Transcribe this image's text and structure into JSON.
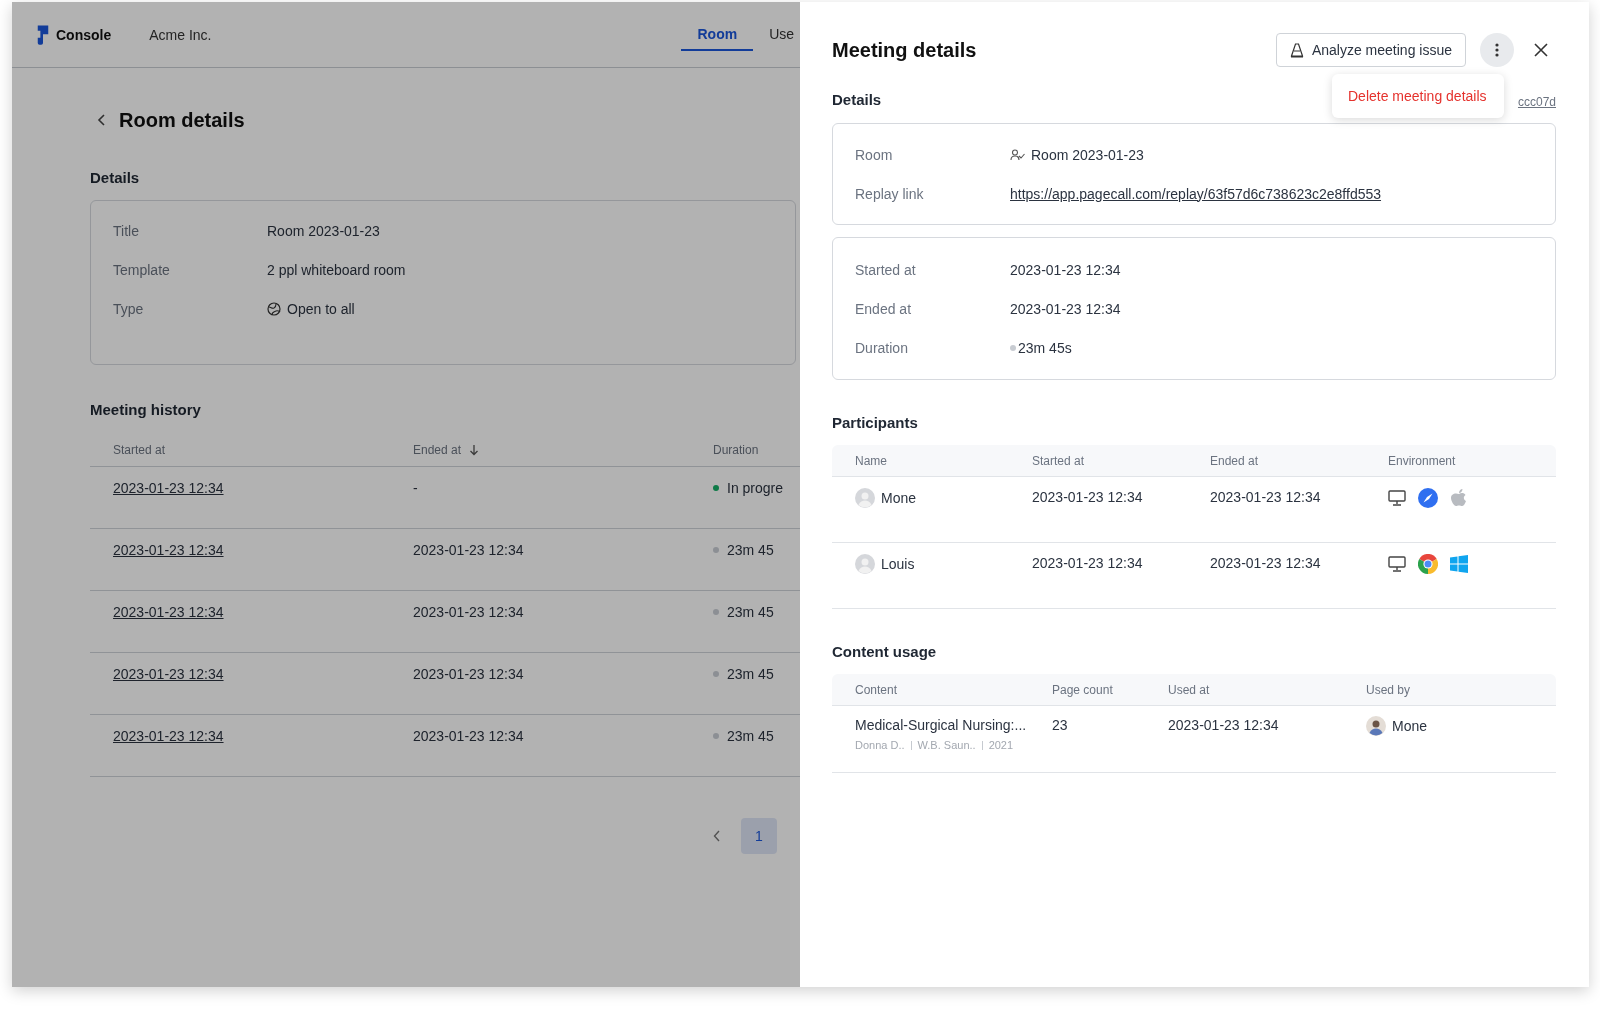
{
  "header": {
    "brand": "Console",
    "org": "Acme Inc.",
    "tabs": [
      {
        "label": "Room",
        "selected": true
      },
      {
        "label": "Use",
        "selected": false
      }
    ]
  },
  "page": {
    "title": "Room details",
    "details_heading": "Details",
    "details": [
      {
        "label": "Title",
        "value": "Room 2023-01-23",
        "kind": "plain"
      },
      {
        "label": "Template",
        "value": "2 ppl whiteboard room",
        "kind": "plain"
      },
      {
        "label": "Type",
        "value": "Open to all",
        "kind": "globe"
      }
    ],
    "history": {
      "heading": "Meeting history",
      "columns": [
        {
          "label": "Started at",
          "sorted": false
        },
        {
          "label": "Ended at",
          "sorted": true
        },
        {
          "label": "Duration",
          "sorted": false
        }
      ],
      "rows": [
        {
          "started": "2023-01-23 12:34",
          "ended": "-",
          "duration": "In progre",
          "color": "#0e7a47"
        },
        {
          "started": "2023-01-23 12:34",
          "ended": "2023-01-23 12:34",
          "duration": "23m 45",
          "color": "#8c8f94"
        },
        {
          "started": "2023-01-23 12:34",
          "ended": "2023-01-23 12:34",
          "duration": "23m 45",
          "color": "#8c8f94"
        },
        {
          "started": "2023-01-23 12:34",
          "ended": "2023-01-23 12:34",
          "duration": "23m 45",
          "color": "#8c8f94"
        },
        {
          "started": "2023-01-23 12:34",
          "ended": "2023-01-23 12:34",
          "duration": "23m 45",
          "color": "#8c8f94"
        }
      ]
    },
    "pagination": [
      {
        "label": "1",
        "selected": true
      }
    ]
  },
  "drawer": {
    "title": "Meeting details",
    "analyze_button": "Analyze meeting issue",
    "menu": {
      "items": [
        "Delete meeting details"
      ]
    },
    "details_heading": "Details",
    "id_link": "ccc07d",
    "room": [
      {
        "label": "Room",
        "value": "Room 2023-01-23",
        "kind": "person"
      },
      {
        "label": "Replay link",
        "value": "https://app.pagecall.com/replay/63f57d6c738623c2e8ffd553",
        "kind": "link"
      }
    ],
    "time": [
      {
        "label": "Started at",
        "value": "2023-01-23 12:34",
        "kind": "plain"
      },
      {
        "label": "Ended at",
        "value": "2023-01-23 12:34",
        "kind": "plain"
      },
      {
        "label": "Duration",
        "value": "23m 45s",
        "kind": "status",
        "color": "#c8ccd2"
      }
    ],
    "participants": {
      "heading": "Participants",
      "columns": [
        "Name",
        "Started at",
        "Ended at",
        "Environment"
      ],
      "rows": [
        {
          "name": "Mone",
          "started": "2023-01-23 12:34",
          "ended": "2023-01-23 12:34",
          "environment": [
            {
              "kind": "desktop"
            },
            {
              "kind": "compass"
            },
            {
              "kind": "apple"
            }
          ]
        },
        {
          "name": "Louis",
          "started": "2023-01-23 12:34",
          "ended": "2023-01-23 12:34",
          "environment": [
            {
              "kind": "desktop"
            },
            {
              "kind": "chrome"
            },
            {
              "kind": "windows"
            }
          ]
        }
      ]
    },
    "content_usage": {
      "heading": "Content usage",
      "columns": [
        "Content",
        "Page count",
        "Used at",
        "Used by"
      ],
      "rows": [
        {
          "title": "Medical-Surgical Nursing:...",
          "meta": [
            "Donna D..",
            "W.B. Saun..",
            "2021"
          ],
          "pages": "23",
          "used_at": "2023-01-23 12:34",
          "used_by": "Mone"
        }
      ]
    }
  }
}
